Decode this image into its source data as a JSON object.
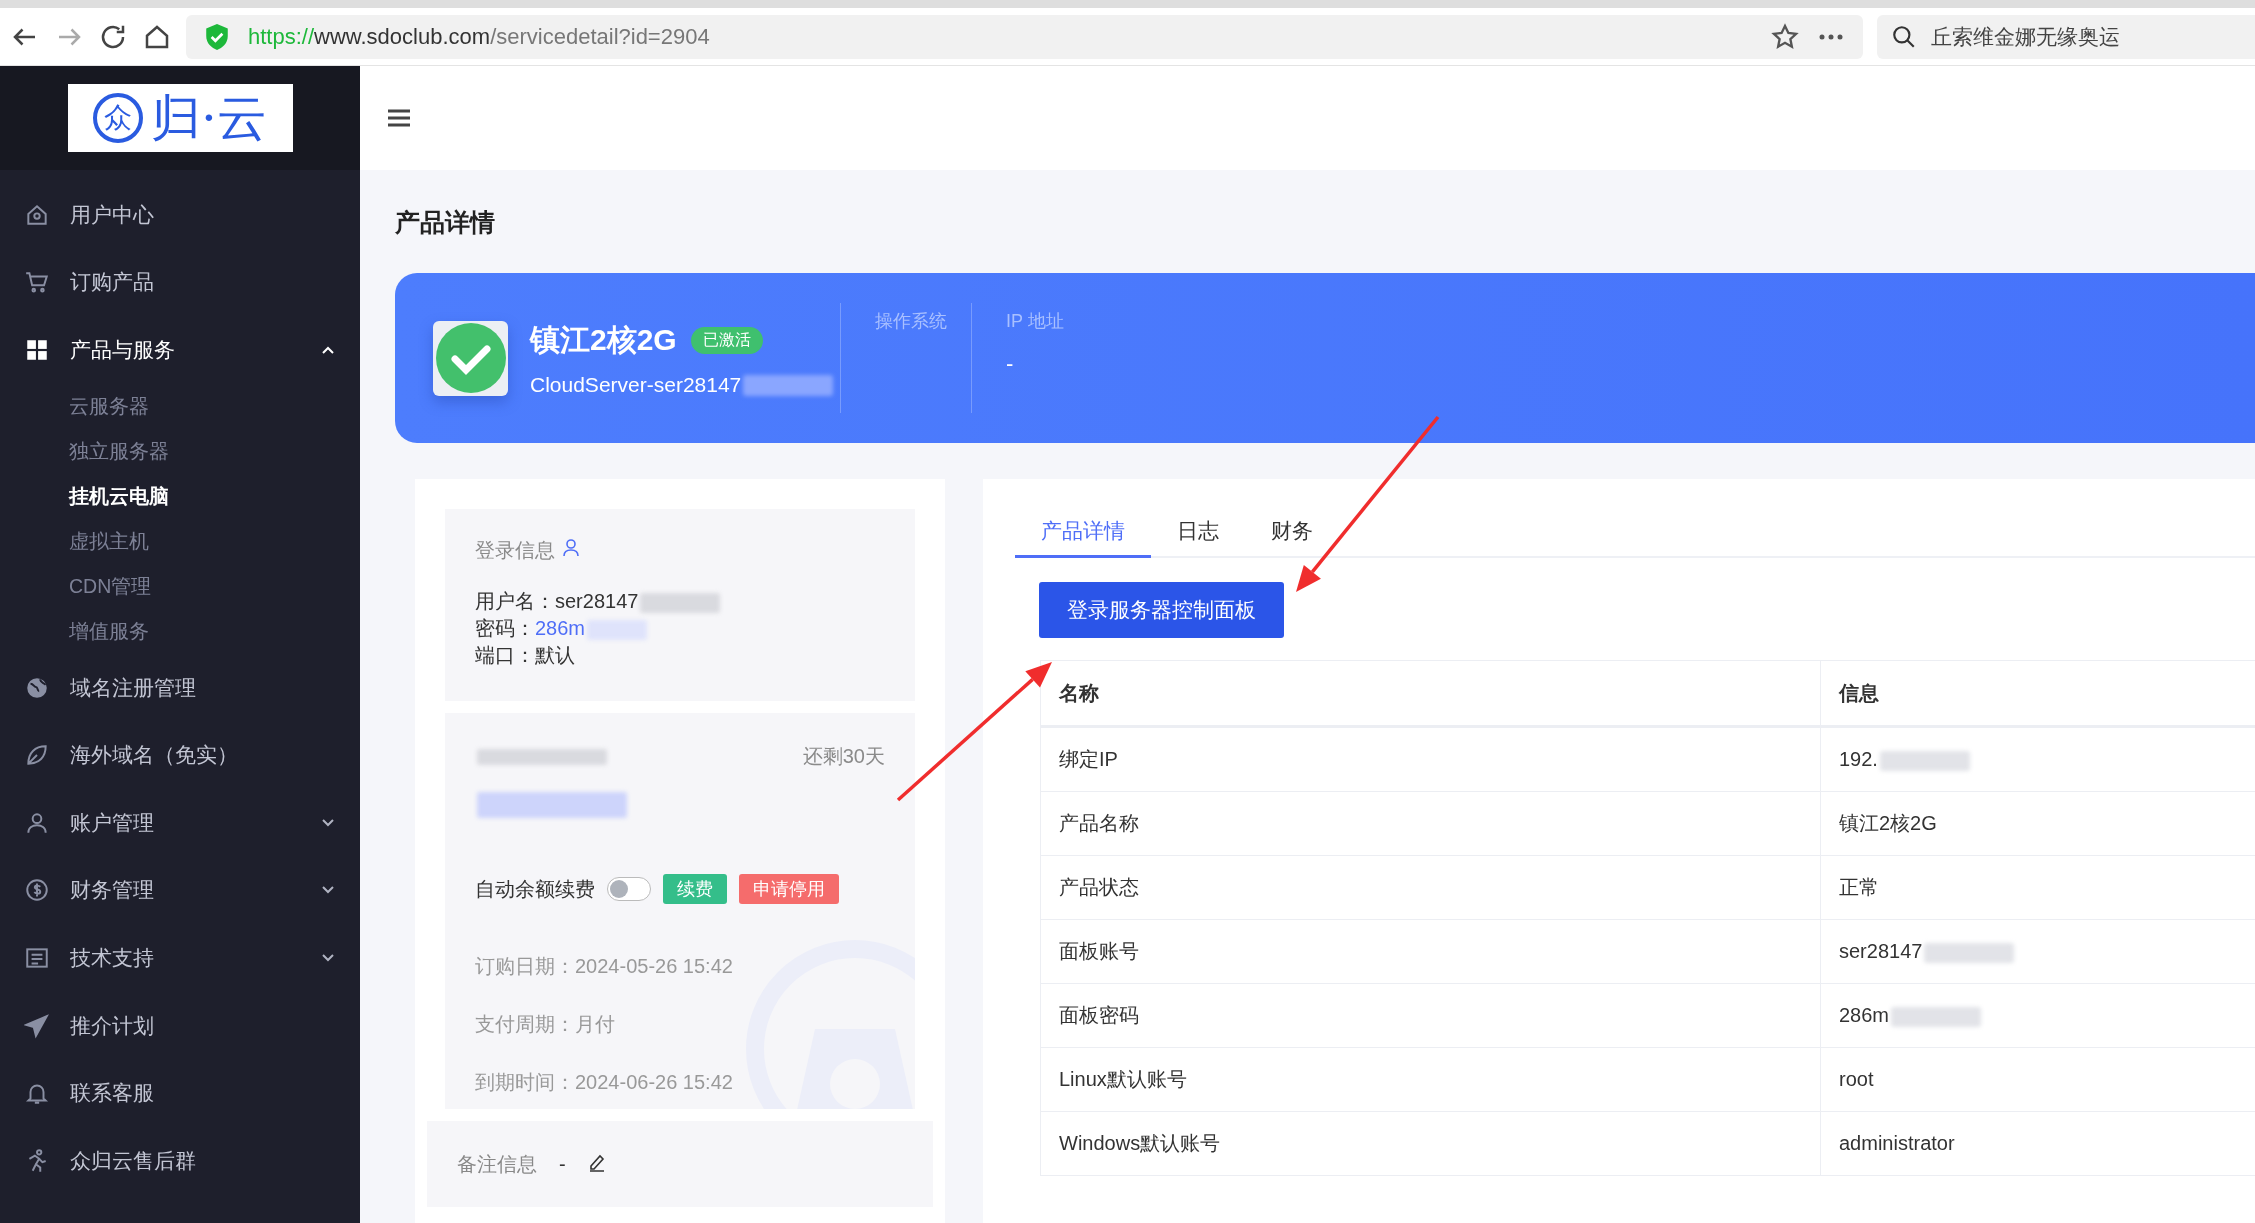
{
  "browser": {
    "url": {
      "scheme": "https://",
      "host": "www.sdoclub.com",
      "path": "/servicedetail?id=2904"
    },
    "search": "丘索维金娜无缘奥运"
  },
  "logo": {
    "mark": "众",
    "text": "归·云"
  },
  "sidebar": {
    "items": [
      {
        "label": "用户中心"
      },
      {
        "label": "订购产品"
      },
      {
        "label": "产品与服务",
        "expanded": true,
        "children": [
          {
            "label": "云服务器",
            "selected": false
          },
          {
            "label": "独立服务器",
            "selected": false
          },
          {
            "label": "挂机云电脑",
            "selected": true
          },
          {
            "label": "虚拟主机",
            "selected": false
          },
          {
            "label": "CDN管理",
            "selected": false
          },
          {
            "label": "增值服务",
            "selected": false
          }
        ]
      },
      {
        "label": "域名注册管理"
      },
      {
        "label": "海外域名（免实）"
      },
      {
        "label": "账户管理",
        "expanded": false
      },
      {
        "label": "财务管理",
        "expanded": false
      },
      {
        "label": "技术支持",
        "expanded": false
      },
      {
        "label": "推介计划"
      },
      {
        "label": "联系客服"
      },
      {
        "label": "众归云售后群"
      }
    ]
  },
  "page_title": "产品详情",
  "banner": {
    "name": "镇江2核2G",
    "badge": "已激活",
    "hostname": "CloudServer-ser28147",
    "hostname_redacted": true,
    "fields": [
      {
        "label": "操作系统"
      },
      {
        "label": "IP 地址",
        "value": "-"
      }
    ]
  },
  "login_info": {
    "title": "登录信息",
    "lines": [
      {
        "label": "用户名：",
        "value": "ser28147",
        "kind": "plain",
        "redacted": true
      },
      {
        "label": "密码：",
        "value": "286m",
        "kind": "link",
        "redacted": true
      },
      {
        "label": "端口：",
        "value": "默认",
        "kind": "plain",
        "redacted": false
      }
    ]
  },
  "subscription": {
    "title_redacted": true,
    "remaining": "还剩30天",
    "amount_redacted": true,
    "auto_renew": {
      "label": "自动余额续费",
      "on": false
    },
    "buttons": [
      {
        "label": "续费",
        "kind": "renew"
      },
      {
        "label": "申请停用",
        "kind": "cancel"
      }
    ],
    "dates": [
      "订购日期：2024-05-26 15:42",
      "支付周期：月付",
      "到期时间：2024-06-26 15:42"
    ]
  },
  "remarks": {
    "label": "备注信息",
    "value": "-"
  },
  "tabs": [
    {
      "label": "产品详情",
      "selected": true
    },
    {
      "label": "日志",
      "selected": false
    },
    {
      "label": "财务",
      "selected": false
    }
  ],
  "primary_button": "登录服务器控制面板",
  "table": {
    "columns": [
      "名称",
      "信息"
    ],
    "rows": [
      {
        "name": "绑定IP",
        "info": "192.",
        "redacted": true
      },
      {
        "name": "产品名称",
        "info": "镇江2核2G",
        "redacted": false
      },
      {
        "name": "产品状态",
        "info": "正常",
        "redacted": false
      },
      {
        "name": "面板账号",
        "info": "ser28147",
        "redacted": true
      },
      {
        "name": "面板密码",
        "info": "286m",
        "redacted": true
      },
      {
        "name": "Linux默认账号",
        "info": "root",
        "redacted": false
      },
      {
        "name": "Windows默认账号",
        "info": "administrator",
        "redacted": false
      }
    ]
  },
  "annotations": [
    {
      "kind": "arrow"
    },
    {
      "kind": "arrow"
    }
  ]
}
